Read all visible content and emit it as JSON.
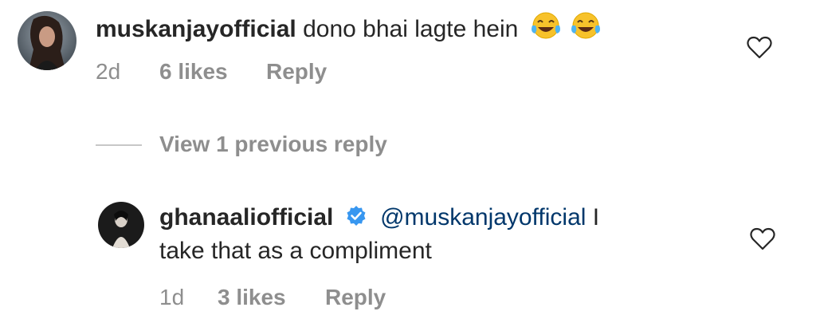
{
  "comment": {
    "username": "muskanjayofficial",
    "text": "dono bhai lagte hein",
    "emoji_icon": "face-with-tears-of-joy-icon",
    "time": "2d",
    "likes": "6 likes",
    "reply_label": "Reply"
  },
  "view_replies": {
    "label": "View 1 previous reply"
  },
  "reply": {
    "username": "ghanaaliofficial",
    "verified_icon": "verified-badge-icon",
    "mention": "@muskanjayofficial",
    "text_part1": " I",
    "text_part2": "take that as a compliment",
    "time": "1d",
    "likes": "3 likes",
    "reply_label": "Reply"
  },
  "colors": {
    "text": "#262626",
    "secondary": "#8e8e8e",
    "mention": "#00376b",
    "verified": "#3897f0"
  }
}
